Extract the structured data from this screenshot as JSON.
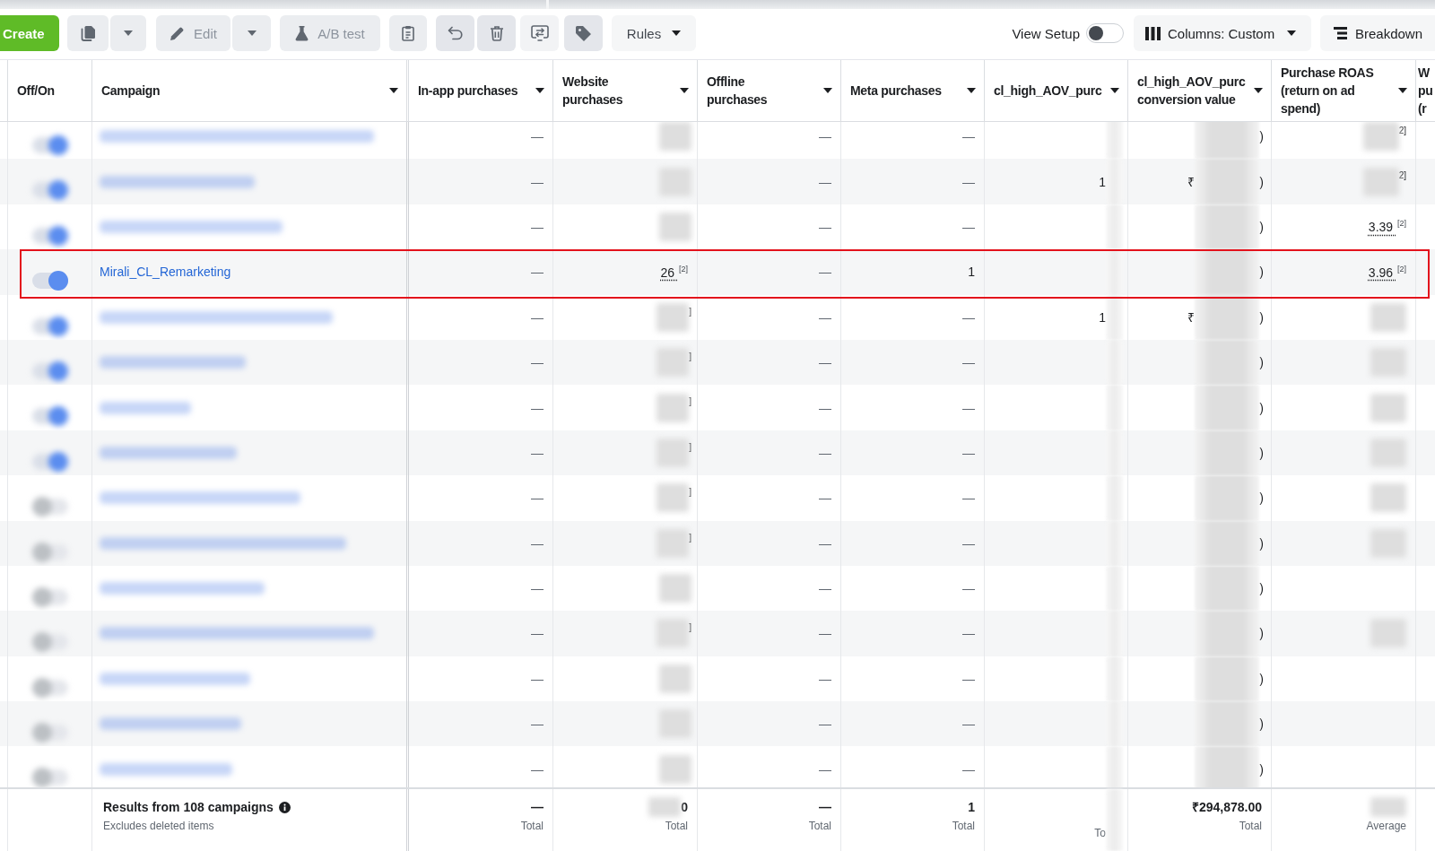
{
  "toolbar": {
    "create": {
      "label": "Create"
    },
    "edit": {
      "label": "Edit",
      "disabled": true
    },
    "ab_test": {
      "label": "A/B test",
      "disabled": true
    },
    "rules": {
      "label": "Rules",
      "disabled": false
    },
    "view_setup": {
      "label": "View Setup",
      "on": false
    },
    "columns": {
      "label": "Columns: Custom"
    },
    "breakdown": {
      "label": "Breakdown"
    }
  },
  "table": {
    "columns": [
      {
        "label": "Off/On",
        "menu": false
      },
      {
        "label": "Campaign",
        "menu": true
      },
      {
        "label": "In-app purchases",
        "menu": true
      },
      {
        "label": "Website purchases",
        "menu": true
      },
      {
        "label": "Offline purchases",
        "menu": true
      },
      {
        "label": "Meta purchases",
        "menu": true
      },
      {
        "label": "cl_high_AOV_purc",
        "menu": true
      },
      {
        "label": "cl_high_AOV_purc conversion value",
        "menu": true
      },
      {
        "label": "Purchase ROAS (return on ad spend)",
        "menu": true
      },
      {
        "label": "W pu (r",
        "menu": false
      }
    ],
    "rows": [
      {
        "on": true,
        "blurred": true,
        "outlined": false,
        "cells": [
          {
            "kind": "dash",
            "text": "—"
          },
          {
            "kind": "blurred"
          },
          {
            "kind": "dash",
            "text": "—"
          },
          {
            "kind": "dash",
            "text": "—"
          },
          {
            "kind": "blurred"
          },
          {
            "kind": "blurred",
            "tail": ")"
          },
          {
            "kind": "blurred",
            "tail": "2]"
          }
        ]
      },
      {
        "on": true,
        "blurred": true,
        "outlined": false,
        "cells": [
          {
            "kind": "dash",
            "text": "—"
          },
          {
            "kind": "blurred"
          },
          {
            "kind": "dash",
            "text": "—"
          },
          {
            "kind": "dash",
            "text": "—"
          },
          {
            "kind": "blurred",
            "head": "1"
          },
          {
            "kind": "blurred",
            "head": "₹",
            "tail": ")"
          },
          {
            "kind": "blurred",
            "tail": "2]"
          }
        ]
      },
      {
        "on": true,
        "blurred": true,
        "outlined": false,
        "cells": [
          {
            "kind": "dash",
            "text": "—"
          },
          {
            "kind": "blurred"
          },
          {
            "kind": "dash",
            "text": "—"
          },
          {
            "kind": "dash",
            "text": "—"
          },
          {
            "kind": "blurred"
          },
          {
            "kind": "blurred",
            "tail": ")"
          },
          {
            "kind": "number",
            "text": "3.39 $^{[2]}$"
          }
        ]
      },
      {
        "on": true,
        "blurred": false,
        "outlined": true,
        "campaign": "Mirali_CL_Remarketing",
        "cells": [
          {
            "kind": "dash",
            "text": "—"
          },
          {
            "kind": "number",
            "text": "26 $^{[2]}$"
          },
          {
            "kind": "dash",
            "text": "—"
          },
          {
            "kind": "plain",
            "text": "1"
          },
          {
            "kind": "blurred"
          },
          {
            "kind": "blurred",
            "tail": ")"
          },
          {
            "kind": "number",
            "text": "3.96 $^{[2]}$"
          }
        ]
      },
      {
        "on": true,
        "blurred": true,
        "outlined": false,
        "cells": [
          {
            "kind": "dash",
            "text": "—"
          },
          {
            "kind": "blurred",
            "tail": "]"
          },
          {
            "kind": "dash",
            "text": "—"
          },
          {
            "kind": "dash",
            "text": "—"
          },
          {
            "kind": "blurred",
            "head": "1"
          },
          {
            "kind": "blurred",
            "head": "₹",
            "tail": ")"
          },
          {
            "kind": "blurred"
          }
        ]
      },
      {
        "on": true,
        "blurred": true,
        "outlined": false,
        "cells": [
          {
            "kind": "dash",
            "text": "—"
          },
          {
            "kind": "blurred",
            "tail": "]"
          },
          {
            "kind": "dash",
            "text": "—"
          },
          {
            "kind": "dash",
            "text": "—"
          },
          {
            "kind": "blurred"
          },
          {
            "kind": "blurred",
            "tail": ")"
          },
          {
            "kind": "blurred"
          }
        ]
      },
      {
        "on": true,
        "blurred": true,
        "outlined": false,
        "cells": [
          {
            "kind": "dash",
            "text": "—"
          },
          {
            "kind": "blurred",
            "tail": "]"
          },
          {
            "kind": "dash",
            "text": "—"
          },
          {
            "kind": "dash",
            "text": "—"
          },
          {
            "kind": "blurred"
          },
          {
            "kind": "blurred",
            "tail": ")"
          },
          {
            "kind": "blurred"
          }
        ]
      },
      {
        "on": true,
        "blurred": true,
        "outlined": false,
        "cells": [
          {
            "kind": "dash",
            "text": "—"
          },
          {
            "kind": "blurred",
            "tail": "]"
          },
          {
            "kind": "dash",
            "text": "—"
          },
          {
            "kind": "dash",
            "text": "—"
          },
          {
            "kind": "blurred"
          },
          {
            "kind": "blurred",
            "tail": ")"
          },
          {
            "kind": "blurred"
          }
        ]
      },
      {
        "on": false,
        "blurred": true,
        "outlined": false,
        "cells": [
          {
            "kind": "dash",
            "text": "—"
          },
          {
            "kind": "blurred",
            "tail": "]"
          },
          {
            "kind": "dash",
            "text": "—"
          },
          {
            "kind": "dash",
            "text": "—"
          },
          {
            "kind": "blurred"
          },
          {
            "kind": "blurred",
            "tail": ")"
          },
          {
            "kind": "blurred"
          }
        ]
      },
      {
        "on": false,
        "blurred": true,
        "outlined": false,
        "cells": [
          {
            "kind": "dash",
            "text": "—"
          },
          {
            "kind": "blurred",
            "tail": "]"
          },
          {
            "kind": "dash",
            "text": "—"
          },
          {
            "kind": "dash",
            "text": "—"
          },
          {
            "kind": "blurred"
          },
          {
            "kind": "blurred",
            "tail": ")"
          },
          {
            "kind": "blurred"
          }
        ]
      },
      {
        "on": false,
        "blurred": true,
        "outlined": false,
        "cells": [
          {
            "kind": "dash",
            "text": "—"
          },
          {
            "kind": "blurred"
          },
          {
            "kind": "dash",
            "text": "—"
          },
          {
            "kind": "dash",
            "text": "—"
          },
          {
            "kind": "blurred"
          },
          {
            "kind": "blurred",
            "tail": ")"
          },
          {
            "kind": "empty"
          }
        ]
      },
      {
        "on": false,
        "blurred": true,
        "outlined": false,
        "cells": [
          {
            "kind": "dash",
            "text": "—"
          },
          {
            "kind": "blurred",
            "tail": "]"
          },
          {
            "kind": "dash",
            "text": "—"
          },
          {
            "kind": "dash",
            "text": "—"
          },
          {
            "kind": "blurred"
          },
          {
            "kind": "blurred",
            "tail": ")"
          },
          {
            "kind": "blurred"
          }
        ]
      },
      {
        "on": false,
        "blurred": true,
        "outlined": false,
        "cells": [
          {
            "kind": "dash",
            "text": "—"
          },
          {
            "kind": "blurred"
          },
          {
            "kind": "dash",
            "text": "—"
          },
          {
            "kind": "dash",
            "text": "—"
          },
          {
            "kind": "blurred"
          },
          {
            "kind": "blurred",
            "tail": ")"
          },
          {
            "kind": "empty"
          }
        ]
      },
      {
        "on": false,
        "blurred": true,
        "outlined": false,
        "cells": [
          {
            "kind": "dash",
            "text": "—"
          },
          {
            "kind": "blurred"
          },
          {
            "kind": "dash",
            "text": "—"
          },
          {
            "kind": "dash",
            "text": "—"
          },
          {
            "kind": "blurred"
          },
          {
            "kind": "blurred",
            "tail": ")"
          },
          {
            "kind": "empty"
          }
        ]
      },
      {
        "on": false,
        "blurred": true,
        "outlined": false,
        "cells": [
          {
            "kind": "dash",
            "text": "—"
          },
          {
            "kind": "blurred"
          },
          {
            "kind": "dash",
            "text": "—"
          },
          {
            "kind": "dash",
            "text": "—"
          },
          {
            "kind": "blurred"
          },
          {
            "kind": "blurred",
            "tail": ")"
          },
          {
            "kind": "empty"
          }
        ]
      }
    ],
    "footer": {
      "title": "Results from 108 campaigns",
      "note": "Excludes deleted items",
      "cells": [
        {
          "kind": "dash",
          "text": "—",
          "sub": "Total"
        },
        {
          "kind": "blurred",
          "tail": "0",
          "sub": "Total"
        },
        {
          "kind": "dash",
          "text": "—",
          "sub": "Total"
        },
        {
          "kind": "plain",
          "text": "1",
          "sub": "Total"
        },
        {
          "kind": "blurred",
          "sub": "To"
        },
        {
          "kind": "plain",
          "text": "₹294,878.00",
          "sub": "Total"
        },
        {
          "kind": "blurred",
          "sub": "Average"
        }
      ]
    }
  }
}
